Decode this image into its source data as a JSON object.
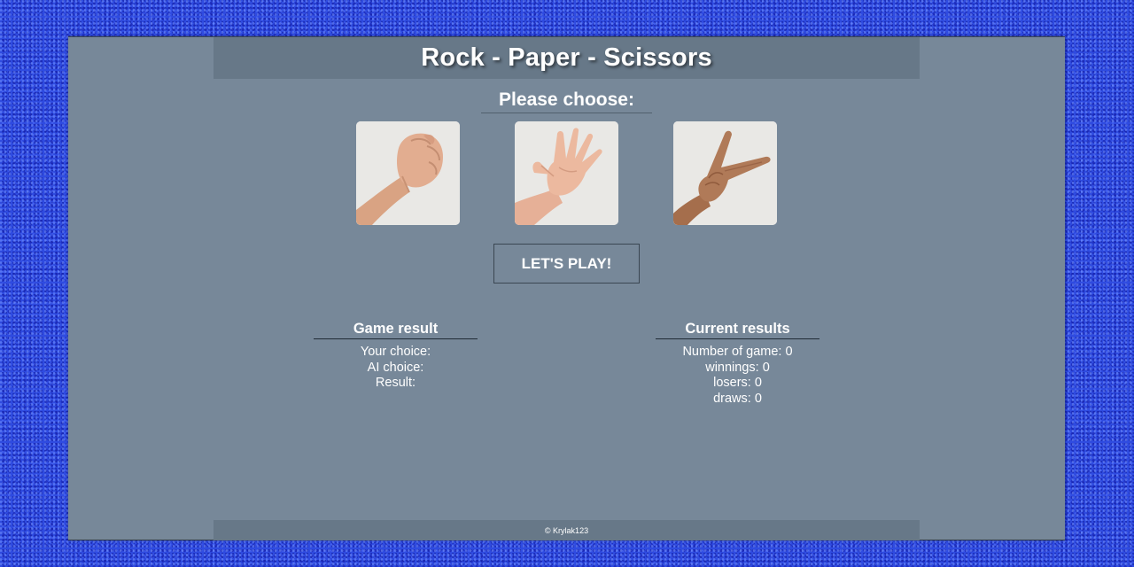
{
  "header": {
    "title": "Rock - Paper - Scissors"
  },
  "selection": {
    "prompt": "Please choose:",
    "options": [
      {
        "name": "rock",
        "icon": "fist-hand-icon"
      },
      {
        "name": "paper",
        "icon": "open-hand-icon"
      },
      {
        "name": "scissors",
        "icon": "victory-hand-icon"
      }
    ]
  },
  "play_button": {
    "label": "LET'S PLAY!"
  },
  "game_result": {
    "title": "Game result",
    "your_choice": "Your choice:",
    "ai_choice": "AI choice:",
    "result": "Result:"
  },
  "current_results": {
    "title": "Current results",
    "games": "Number of game: 0",
    "winnings": "winnings: 0",
    "losers": "losers: 0",
    "draws": "draws: 0"
  },
  "footer": {
    "copyright": "© Krylak123"
  },
  "colors": {
    "page_background": "#2f4be0",
    "panel_background": "#778899",
    "header_background": "#677888",
    "text": "#ffffff"
  }
}
